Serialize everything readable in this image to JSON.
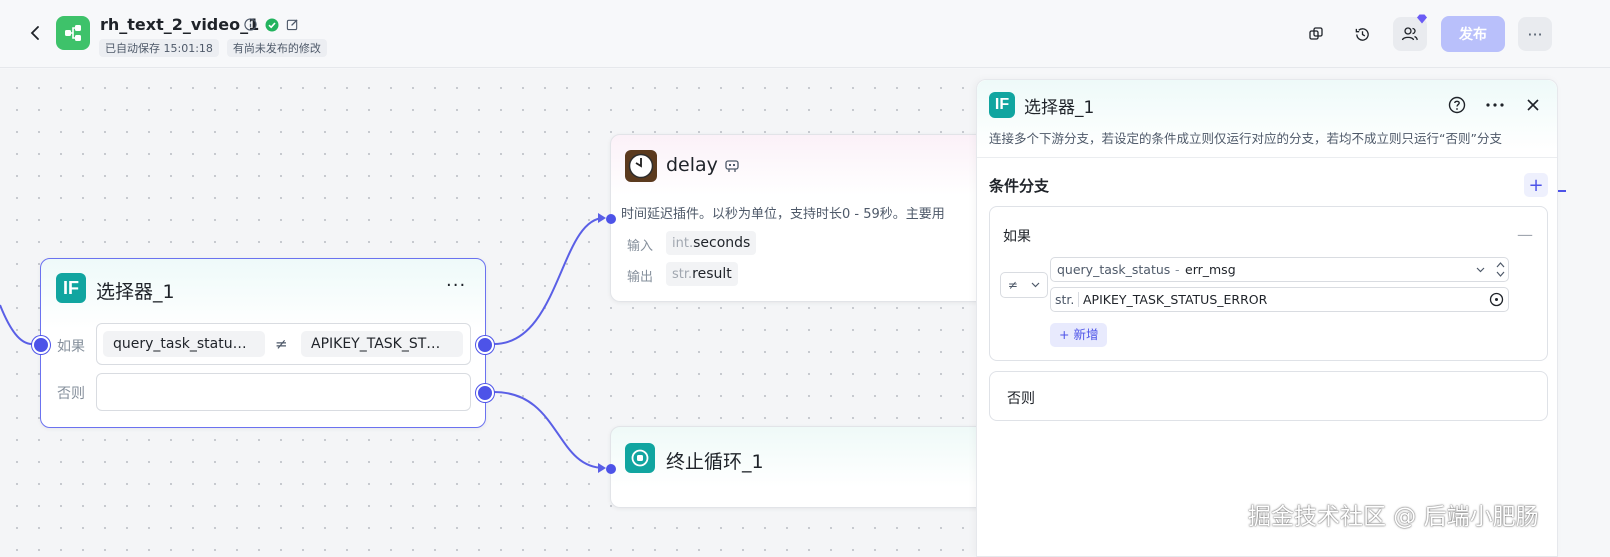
{
  "header": {
    "title": "rh_text_2_video_1",
    "autosave": "已自动保存 15:01:18",
    "unpublished": "有尚未发布的修改",
    "publish_label": "发布",
    "more_label": "···"
  },
  "canvas": {
    "selector_node": {
      "title": "选择器_1",
      "if_badge": "IF",
      "more": "···",
      "if_label": "如果",
      "else_label": "否则",
      "left_operand": "query_task_statu…",
      "operator": "≠",
      "right_operand": "APIKEY_TASK_ST…"
    },
    "delay_node": {
      "title": "delay",
      "description": "时间延迟插件。以秒为单位，支持时长0 - 59秒。主要用",
      "input_label": "输入",
      "input_type": "int.",
      "input_name": "seconds",
      "output_label": "输出",
      "output_type": "str.",
      "output_name": "result"
    },
    "stop_node": {
      "title": "终止循环_1"
    }
  },
  "panel": {
    "if_badge": "IF",
    "title": "选择器_1",
    "description": "连接多个下游分支，若设定的条件成立则仅运行对应的分支，若均不成立则只运行“否则”分支",
    "section_title": "条件分支",
    "add_label": "+",
    "if_card": {
      "label": "如果",
      "minus": "—",
      "operator": "≠",
      "var_name": "query_task_status",
      "var_sep": "-",
      "var_field": "err_msg",
      "value_type": "str.",
      "value": "APIKEY_TASK_STATUS_ERROR",
      "add_cond_label": "+ 新增"
    },
    "else_card": {
      "label": "否则"
    }
  },
  "watermark": "掘金技术社区 @ 后端小肥肠",
  "colors": {
    "accent": "#4d53e8",
    "publish_disabled": "#b9c0fb",
    "if_badge": "#11a5a0",
    "logo_green": "#3ec26a"
  }
}
